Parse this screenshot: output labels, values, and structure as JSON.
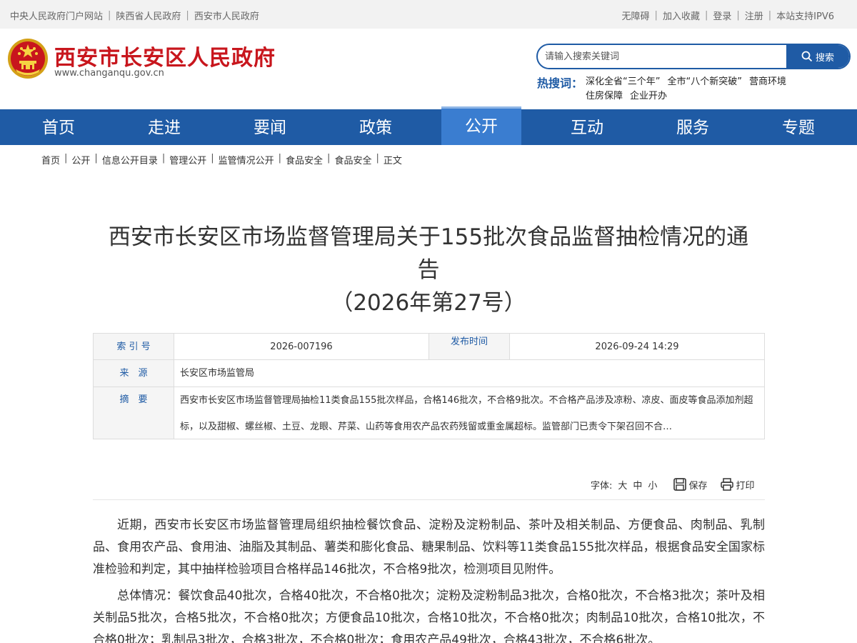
{
  "topbar": {
    "left_links": [
      "中央人民政府门户网站",
      "陕西省人民政府",
      "西安市人民政府"
    ],
    "right_links": [
      "无障碍",
      "加入收藏",
      "登录",
      "注册",
      "本站支持IPV6"
    ]
  },
  "header": {
    "site_name": "西安市长安区人民政府",
    "site_domain": "www.changanqu.gov.cn",
    "search_placeholder": "请输入搜索关键词",
    "search_button": "搜索",
    "hot_label": "热搜词：",
    "hot_words": [
      "深化全省“三个年”",
      "全市“八个新突破”",
      "营商环境",
      "住房保障",
      "企业开办"
    ]
  },
  "nav": {
    "items": [
      "首页",
      "走进",
      "要闻",
      "政策",
      "公开",
      "互动",
      "服务",
      "专题"
    ],
    "active": "公开"
  },
  "breadcrumb": [
    "首页",
    "公开",
    "信息公开目录",
    "管理公开",
    "监管情况公开",
    "食品安全",
    "食品安全",
    "正文"
  ],
  "article": {
    "title_line1": "西安市长安区市场监督管理局关于155批次食品监督抽检情况的通",
    "title_line2": "告",
    "title_line3": "（2026年第27号）",
    "info": {
      "index_label": "索 引 号",
      "index_value": "2026-007196",
      "date_label": "发布时间",
      "date_value": "2026-09-24 14:29",
      "source_label": "来　源",
      "source_value": "长安区市场监管局",
      "summary_label": "摘　要",
      "summary_value": "西安市长安区市场监督管理局抽检11类食品155批次样品，合格146批次，不合格9批次。不合格产品涉及凉粉、凉皮、面皮等食品添加剂超标，以及甜椒、螺丝椒、土豆、龙眼、芹菜、山药等食用农产品农药残留或重金属超标。监管部门已责令下架召回不合…"
    },
    "tools": {
      "font_label": "字体:",
      "size_large": "大",
      "size_medium": "中",
      "size_small": "小",
      "save": "保存",
      "print": "打印"
    },
    "paragraphs": [
      "近期，西安市长安区市场监督管理局组织抽检餐饮食品、淀粉及淀粉制品、茶叶及相关制品、方便食品、肉制品、乳制品、食用农产品、食用油、油脂及其制品、薯类和膨化食品、糖果制品、饮料等11类食品155批次样品，根据食品安全国家标准检验和判定，其中抽样检验项目合格样品146批次，不合格9批次，检测项目见附件。",
      "总体情况：餐饮食品40批次，合格40批次，不合格0批次；淀粉及淀粉制品3批次，合格0批次，不合格3批次；茶叶及相关制品5批次，合格5批次，不合格0批次；方便食品10批次，合格10批次，不合格0批次；肉制品10批次，合格10批次，不合格0批次；乳制品3批次，合格3批次，不合格0批次；食用农产品49批次，合格43批次，不合格6批次。"
    ]
  },
  "colors": {
    "brand_red": "#c8161d",
    "nav_blue": "#1f5ba5",
    "nav_active": "#3a7dd0"
  }
}
